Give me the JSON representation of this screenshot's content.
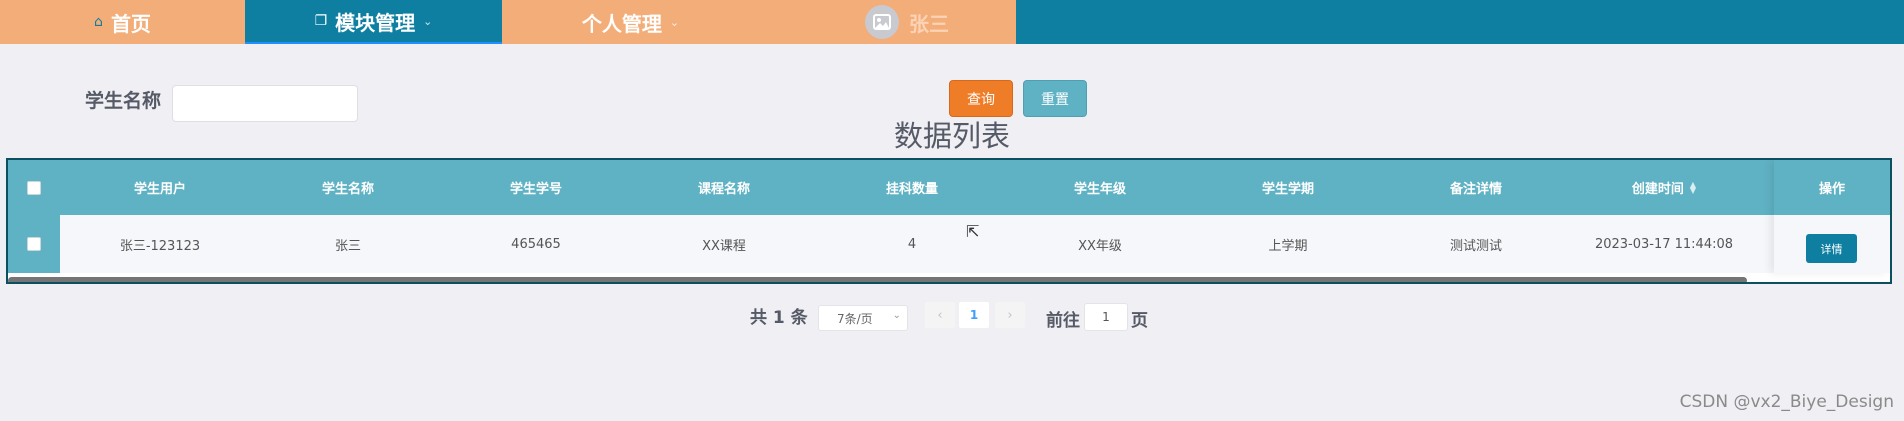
{
  "nav": {
    "home": {
      "icon": "home-icon",
      "label": "首页"
    },
    "module": {
      "icon": "copy-icon",
      "label": "模块管理"
    },
    "personal": {
      "label": "个人管理"
    },
    "user": {
      "icon": "image-icon",
      "name": "张三"
    }
  },
  "colors": {
    "nav_orange": "#f3ad78",
    "nav_teal": "#0e7fa1",
    "header_teal": "#5fb2c4",
    "query_orange": "#ef7d28"
  },
  "search": {
    "label": "学生名称",
    "value": "",
    "query_btn": "查询",
    "reset_btn": "重置"
  },
  "list_title": "数据列表",
  "table": {
    "columns": [
      "学生用户",
      "学生名称",
      "学生学号",
      "课程名称",
      "挂科数量",
      "学生年级",
      "学生学期",
      "备注详情",
      "创建时间",
      "操作"
    ],
    "rows": [
      [
        "张三-123123",
        "张三",
        "465465",
        "XX课程",
        "4",
        "XX年级",
        "上学期",
        "测试测试",
        "2023-03-17 11:44:08"
      ]
    ],
    "detail_btn": "详情"
  },
  "pagination": {
    "total": "共 1 条",
    "page_size": "7条/页",
    "current": "1",
    "goto": "前往",
    "goto_value": "1",
    "page_suffix": "页"
  },
  "watermark": "CSDN @vx2_Biye_Design"
}
